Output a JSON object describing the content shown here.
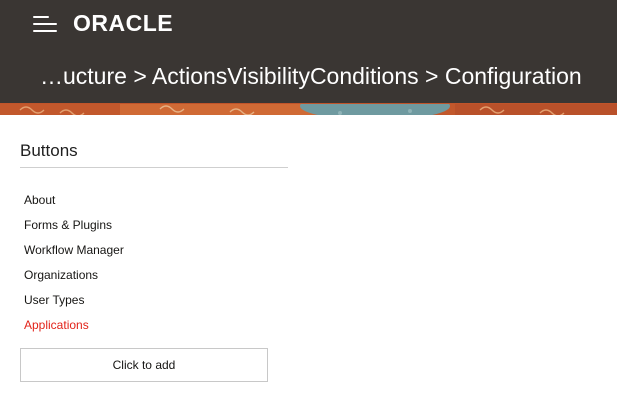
{
  "header": {
    "logo_text": "ORACLE",
    "breadcrumb": "…ucture > ActionsVisibilityConditions > Configuration",
    "background_color": "#3a3633"
  },
  "icons": {
    "menu": "hamburger-menu-icon"
  },
  "panel": {
    "title": "Buttons",
    "items": [
      {
        "label": "About",
        "active": false
      },
      {
        "label": "Forms & Plugins",
        "active": false
      },
      {
        "label": "Workflow Manager",
        "active": false
      },
      {
        "label": "Organizations",
        "active": false
      },
      {
        "label": "User Types",
        "active": false
      },
      {
        "label": "Applications",
        "active": true
      }
    ],
    "add_button_label": "Click to add",
    "active_color": "#e2231a"
  }
}
